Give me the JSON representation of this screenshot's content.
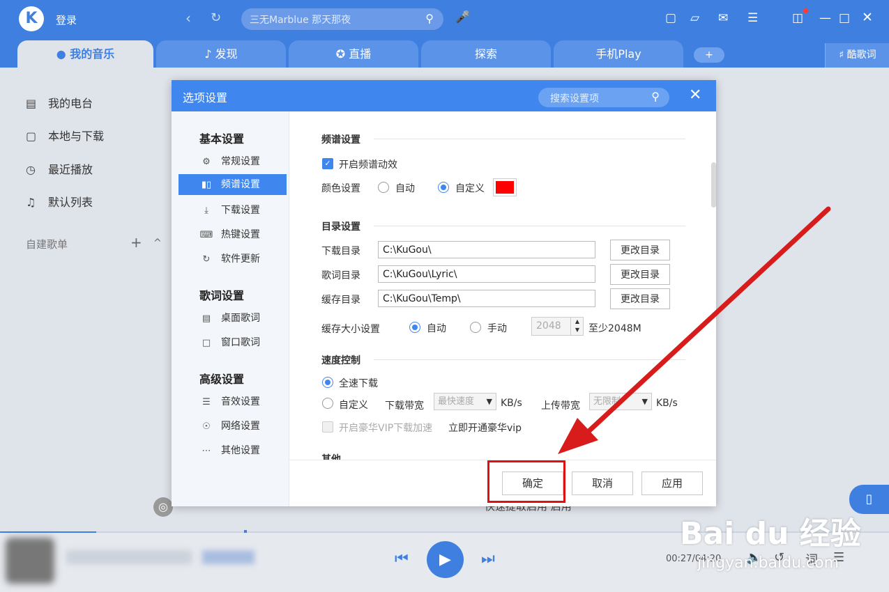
{
  "header": {
    "logo_letter": "K",
    "login": "登录",
    "search_placeholder": "三无Marblue 那天那夜",
    "tabs": [
      {
        "label": "我的音乐",
        "icon": "person-icon"
      },
      {
        "label": "发现",
        "icon": "note-icon"
      },
      {
        "label": "直播",
        "icon": "star-icon"
      },
      {
        "label": "探索",
        "icon": ""
      },
      {
        "label": "手机Play",
        "icon": ""
      }
    ],
    "tab_plus": "+",
    "kulyric": "酷歌词"
  },
  "sidebar": {
    "items": [
      {
        "label": "我的电台",
        "icon": "radio-icon"
      },
      {
        "label": "本地与下载",
        "icon": "monitor-icon"
      },
      {
        "label": "最近播放",
        "icon": "clock-icon"
      },
      {
        "label": "默认列表",
        "icon": "list-icon"
      }
    ],
    "selfmade": "自建歌单",
    "add": "+",
    "collapse": "^"
  },
  "dialog": {
    "title": "选项设置",
    "search_placeholder": "搜索设置项",
    "close": "✕",
    "groups": [
      {
        "title": "基本设置",
        "items": [
          "常规设置",
          "频谱设置",
          "下载设置",
          "热键设置",
          "软件更新"
        ]
      },
      {
        "title": "歌词设置",
        "items": [
          "桌面歌词",
          "窗口歌词"
        ]
      },
      {
        "title": "高级设置",
        "items": [
          "音效设置",
          "网络设置",
          "其他设置"
        ]
      }
    ],
    "spectrum": {
      "title": "频谱设置",
      "enable_label": "开启频谱动效",
      "color_label": "颜色设置",
      "auto": "自动",
      "custom": "自定义",
      "color": "#ff0000"
    },
    "directory": {
      "title": "目录设置",
      "rows": [
        {
          "label": "下载目录",
          "value": "C:\\KuGou\\",
          "button": "更改目录"
        },
        {
          "label": "歌词目录",
          "value": "C:\\KuGou\\Lyric\\",
          "button": "更改目录"
        },
        {
          "label": "缓存目录",
          "value": "C:\\KuGou\\Temp\\",
          "button": "更改目录"
        }
      ],
      "cache_size_label": "缓存大小设置",
      "auto": "自动",
      "manual": "手动",
      "cache_value": "2048",
      "cache_hint": "至少2048M"
    },
    "speed": {
      "title": "速度控制",
      "full_speed": "全速下载",
      "custom": "自定义",
      "download_bw": "下载带宽",
      "download_value": "最快速度",
      "unit": "KB/s",
      "upload_bw": "上传带宽",
      "upload_value": "无限制",
      "vip_label": "开启豪华VIP下载加速",
      "vip_link": "立即开通豪华vip"
    },
    "other_title": "其他",
    "buttons": {
      "ok": "确定",
      "cancel": "取消",
      "apply": "应用"
    }
  },
  "player": {
    "time": "00:27/04:20",
    "lyric_btn": "词",
    "background_text": "快速提取启用   启用"
  },
  "watermark": {
    "brand": "Bai du 经验",
    "url": "jingyan.baidu.com"
  }
}
